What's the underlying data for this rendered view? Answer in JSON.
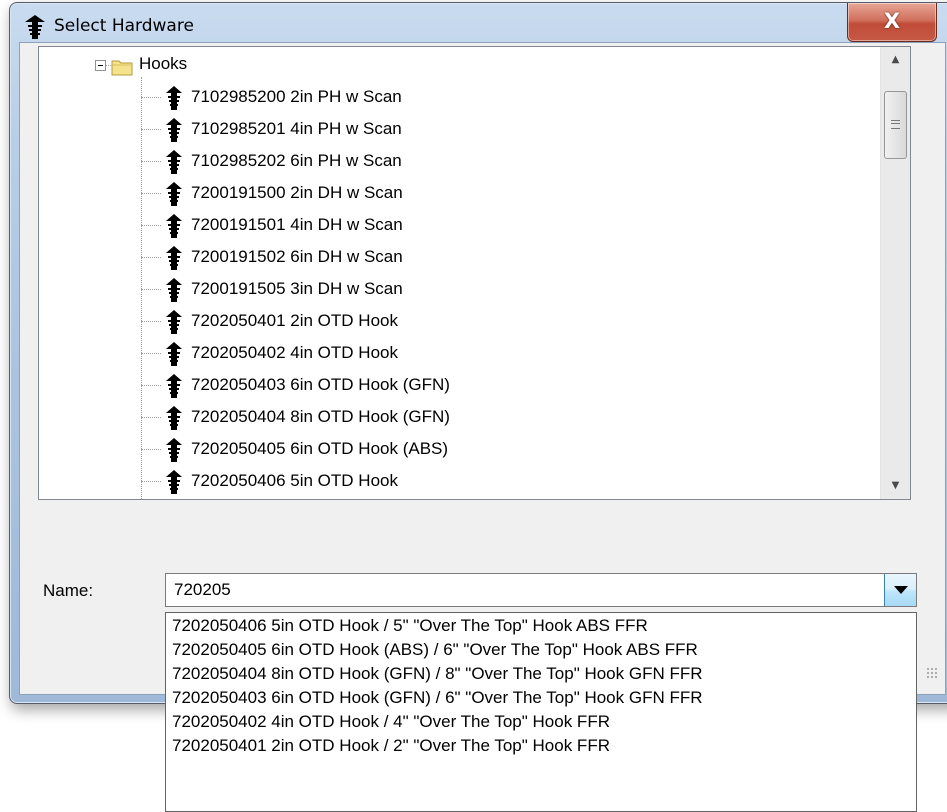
{
  "window": {
    "title": "Select Hardware",
    "close_label": "X"
  },
  "tree": {
    "folder_label": "Hooks",
    "items": [
      "7102985200 2in PH w Scan",
      "7102985201 4in PH w Scan",
      "7102985202 6in PH w Scan",
      "7200191500 2in DH w Scan",
      "7200191501 4in DH w Scan",
      "7200191502 6in DH w Scan",
      "7200191505 3in DH w Scan",
      "7202050401 2in OTD Hook",
      "7202050402 4in OTD Hook",
      "7202050403 6in OTD Hook (GFN)",
      "7202050404 8in OTD Hook (GFN)",
      "7202050405 6in OTD Hook (ABS)",
      "7202050406 5in OTD Hook"
    ]
  },
  "name_field": {
    "label": "Name:",
    "value": "720205"
  },
  "dropdown": {
    "items": [
      "7202050406 5in OTD Hook / 5\" \"Over The Top\" Hook ABS FFR",
      "7202050405 6in OTD Hook (ABS) / 6\" \"Over The Top\" Hook ABS FFR",
      "7202050404 8in OTD Hook (GFN) / 8\" \"Over The Top\" Hook GFN FFR",
      "7202050403 6in OTD Hook (GFN) / 6\" \"Over The Top\" Hook GFN FFR",
      "7202050402 4in OTD Hook / 4\" \"Over The Top\" Hook FFR",
      "7202050401 2in OTD Hook / 2\" \"Over The Top\" Hook FFR"
    ]
  },
  "icons": {
    "app": "hardware-fastener-icon",
    "folder": "folder-icon",
    "item": "hardware-fastener-icon"
  },
  "colors": {
    "frame": "#b9cfe8",
    "close_button": "#c75a45",
    "folder": "#f5e28c",
    "combo_button": "#bee6fd"
  }
}
